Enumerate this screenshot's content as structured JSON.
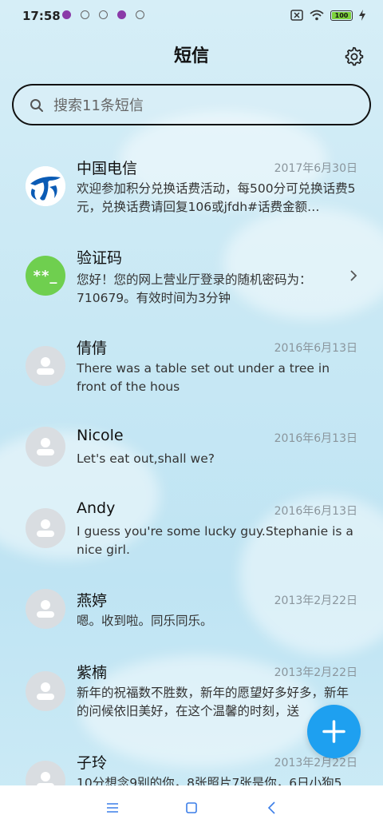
{
  "status_bar": {
    "time": "17:58",
    "battery": "100"
  },
  "header": {
    "title": "短信"
  },
  "search": {
    "placeholder": "搜索11条短信"
  },
  "conversations": [
    {
      "name": "中国电信",
      "date": "2017年6月30日",
      "preview": "欢迎参加积分兑换话费活动，每500分可兑换话费5元，兑换话费请回复106或jfdh#话费金额…",
      "avatar": "china-telecom-logo"
    },
    {
      "name": "验证码",
      "date": "",
      "preview": "您好！您的网上营业厅登录的随机密码为：710679。有效时间为3分钟",
      "avatar": "verification-code",
      "avatar_text": "**_"
    },
    {
      "name": "倩倩",
      "date": "2016年6月13日",
      "preview": "There was a table set out under a tree in front of the hous",
      "avatar": "person"
    },
    {
      "name": "Nicole",
      "date": "2016年6月13日",
      "preview": "Let's eat out,shall we?",
      "avatar": "person"
    },
    {
      "name": "Andy",
      "date": "2016年6月13日",
      "preview": "I guess you're some lucky guy.Stephanie is a nice girl.",
      "avatar": "person"
    },
    {
      "name": "燕婷",
      "date": "2013年2月22日",
      "preview": "嗯。收到啦。同乐同乐。",
      "avatar": "person"
    },
    {
      "name": "紫楠",
      "date": "2013年2月22日",
      "preview": "新年的祝福数不胜数，新年的愿望好多好多，新年的问候依旧美好，在这个温馨的时刻，送",
      "avatar": "person"
    },
    {
      "name": "子玲",
      "date": "2013年2月22日",
      "preview": "10分想念9别的你，8张照片7张是你，6日小狗5",
      "avatar": "person"
    }
  ],
  "colors": {
    "fab": "#1ea0f0",
    "verify_avatar": "#6fcf4f",
    "telecom_blue": "#0a5bb5"
  }
}
